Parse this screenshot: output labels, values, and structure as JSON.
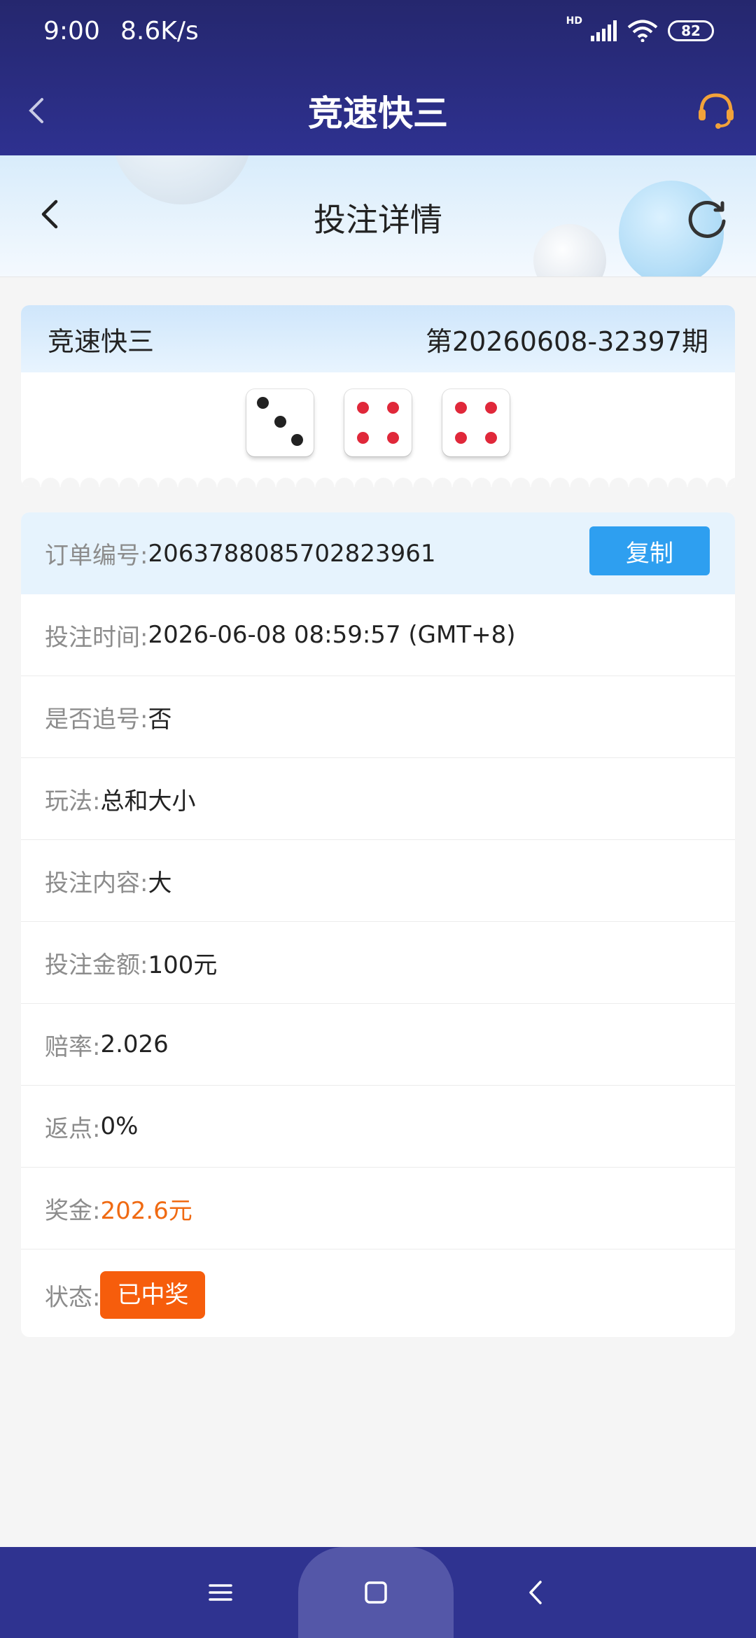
{
  "status_bar": {
    "time": "9:00",
    "speed": "8.6K/s",
    "hd": "HD",
    "battery": "82"
  },
  "app_bar": {
    "title": "竞速快三"
  },
  "sub_header": {
    "title": "投注详情"
  },
  "lottery": {
    "name": "竞速快三",
    "issue": "第20260608-32397期",
    "dice": [
      3,
      4,
      4
    ]
  },
  "details": {
    "order_label": "订单编号:",
    "order_value": "2063788085702823961",
    "copy_label": "复制",
    "time_label": "投注时间:",
    "time_value": "2026-06-08 08:59:57 (GMT+8)",
    "chase_label": "是否追号:",
    "chase_value": "否",
    "play_label": "玩法:",
    "play_value": "总和大小",
    "content_label": "投注内容:",
    "content_value": "大",
    "amount_label": "投注金额:",
    "amount_value": "100元",
    "odds_label": "赔率:",
    "odds_value": "2.026",
    "rebate_label": "返点:",
    "rebate_value": "0%",
    "prize_label": "奖金:",
    "prize_value": "202.6元",
    "status_label": "状态:",
    "status_value": "已中奖"
  },
  "colors": {
    "header_bg": "#2e3190",
    "accent_blue": "#2e9ff0",
    "prize_orange": "#f06a12",
    "badge_orange": "#f65d0c"
  },
  "icons": [
    "back-arrow-icon",
    "headset-support-icon",
    "refresh-icon",
    "menu-icon",
    "home-icon",
    "nav-back-icon"
  ]
}
